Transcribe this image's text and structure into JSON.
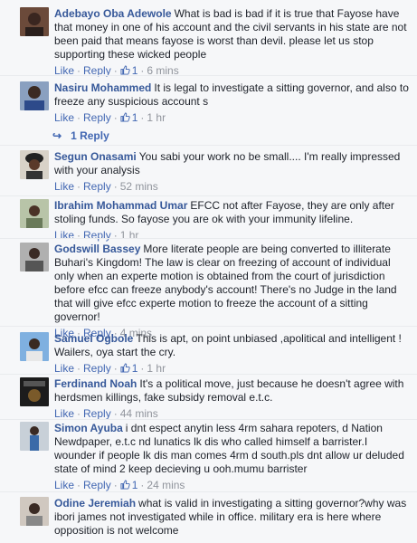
{
  "labels": {
    "like": "Like",
    "reply": "Reply"
  },
  "colors": {
    "link": "#4267b2",
    "author": "#365899",
    "meta": "#90949c",
    "background": "#f6f7f9"
  },
  "comments": [
    {
      "author": "Adebayo Oba Adewole",
      "text": "What is bad is bad if it is true that Fayose have that money in one of his account and the civil servants in his state are not been paid that means fayose is worst than devil. please let us stop supporting these wicked people",
      "likes": "1",
      "time": "6 mins",
      "avatar": "avatar-photo-man-dark"
    },
    {
      "author": "Nasiru Mohammed",
      "text": "It is legal to investigate a sitting governor, and also to freeze any suspicious account s",
      "likes": "1",
      "time": "1 hr",
      "avatar": "avatar-photo-man-blue",
      "replies": "1 Reply"
    },
    {
      "author": "Segun Onasami",
      "text": "You sabi your work no be small.... I'm really impressed with your analysis",
      "likes": "",
      "time": "52 mins",
      "avatar": "avatar-photo-woman-headwrap"
    },
    {
      "author": "Ibrahim Mohammad Umar",
      "text": "EFCC not after Fayose, they are only after stoling funds. So fayose you are ok with your immunity lifeline.",
      "likes": "",
      "time": "1 hr",
      "avatar": "avatar-photo-man-outdoor"
    },
    {
      "author": "Godswill Bassey",
      "text": "More literate people are being converted to illiterate Buhari's Kingdom! The law is clear on freezing of account of individual only when an experte motion is obtained from the court of jurisdiction before efcc can freeze anybody's account! There's no Judge in the land that will give efcc experte motion to freeze the account of a sitting governor!",
      "likes": "",
      "time": "4 mins",
      "avatar": "avatar-photo-man-grey"
    },
    {
      "author": "Samuel Ogbole",
      "text": "This is apt, on point unbiased ,apolitical and intelligent ! Wailers, oya start the cry.",
      "likes": "1",
      "time": "1 hr",
      "avatar": "avatar-photo-man-sky"
    },
    {
      "author": "Ferdinand Noah",
      "text": "It's a political move, just because he doesn't agree with herdsmen killings, fake subsidy removal e.t.c.",
      "likes": "",
      "time": "44 mins",
      "avatar": "avatar-photo-dark-poster"
    },
    {
      "author": "Simon Ayuba",
      "text": "i dnt espect anytin less 4rm sahara repoters, d Nation Newdpaper, e.t.c nd lunatics lk dis who called himself a barrister.I wounder if people lk dis man comes 4rm d south.pls dnt allow ur deluded state of mind 2 keep decieving u ooh.mumu barrister",
      "likes": "1",
      "time": "24 mins",
      "avatar": "avatar-photo-man-standing"
    },
    {
      "author": "Odine Jeremiah",
      "text": "what is valid in investigating a sitting governor?why was ibori james not investigated while in office. military era is here where opposition is not welcome",
      "likes": "",
      "time": "",
      "avatar": "avatar-photo-man-plain"
    }
  ]
}
